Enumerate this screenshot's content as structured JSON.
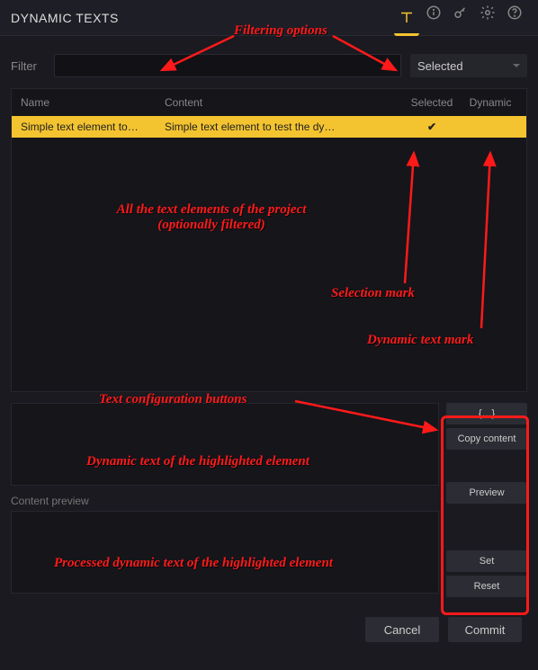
{
  "titlebar": {
    "title": "DYNAMIC TEXTS"
  },
  "filter": {
    "label": "Filter",
    "value": "",
    "dropdown": "Selected"
  },
  "table": {
    "headers": {
      "name": "Name",
      "content": "Content",
      "selected": "Selected",
      "dynamic": "Dynamic"
    },
    "rows": [
      {
        "name": "Simple text element to…",
        "content": "Simple text element to test the dy…",
        "selected": "✔",
        "dynamic": ""
      }
    ]
  },
  "editor": {
    "preview_label": "Content preview"
  },
  "side_buttons": {
    "braces": "{…}",
    "copy": "Copy content",
    "preview": "Preview",
    "set": "Set",
    "reset": "Reset"
  },
  "footer": {
    "cancel": "Cancel",
    "commit": "Commit"
  },
  "annotations": {
    "filtering": "Filtering options",
    "all_elements_l1": "All the text elements of the project",
    "all_elements_l2": "(optionally filtered)",
    "selection_mark": "Selection mark",
    "dynamic_mark": "Dynamic text mark",
    "config_buttons": "Text configuration buttons",
    "dynamic_text": "Dynamic text of the highlighted element",
    "processed_text": "Processed dynamic text of the highlighted element"
  }
}
